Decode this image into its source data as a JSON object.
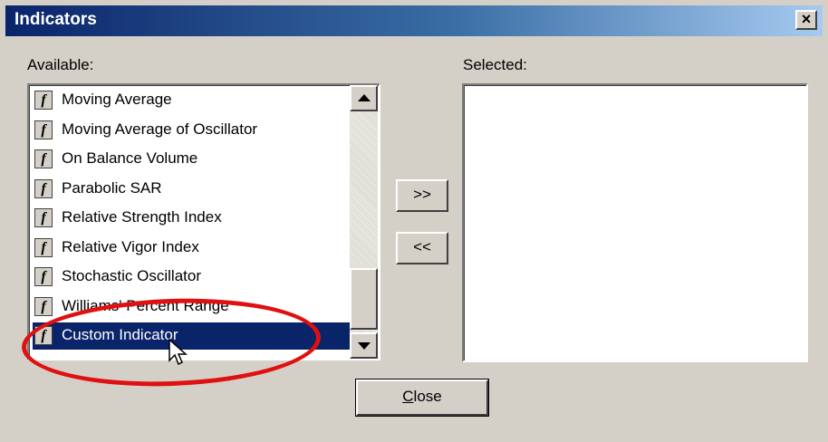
{
  "window": {
    "title": "Indicators",
    "close_glyph": "×"
  },
  "available": {
    "label": "Available:",
    "items": [
      {
        "label": "Moving Average",
        "icon_glyph": "f"
      },
      {
        "label": "Moving Average of Oscillator",
        "icon_glyph": "f"
      },
      {
        "label": "On Balance Volume",
        "icon_glyph": "f"
      },
      {
        "label": "Parabolic SAR",
        "icon_glyph": "f"
      },
      {
        "label": "Relative Strength Index",
        "icon_glyph": "f"
      },
      {
        "label": "Relative Vigor Index",
        "icon_glyph": "f"
      },
      {
        "label": "Stochastic Oscillator",
        "icon_glyph": "f"
      },
      {
        "label": "Williams' Percent Range",
        "icon_glyph": "f"
      },
      {
        "label": "Custom Indicator",
        "icon_glyph": "f",
        "selected": true
      }
    ]
  },
  "selected": {
    "label": "Selected:",
    "items": []
  },
  "buttons": {
    "add_label": ">>",
    "remove_label": "<<",
    "close_mnemonic": "C",
    "close_rest": "lose"
  },
  "colors": {
    "selection": "#0a246a",
    "annotation": "#e01010",
    "title_start": "#0a246a",
    "title_end": "#a6caf0"
  },
  "icons": {
    "indicator": "function-icon",
    "cursor": "arrow-cursor-icon"
  }
}
